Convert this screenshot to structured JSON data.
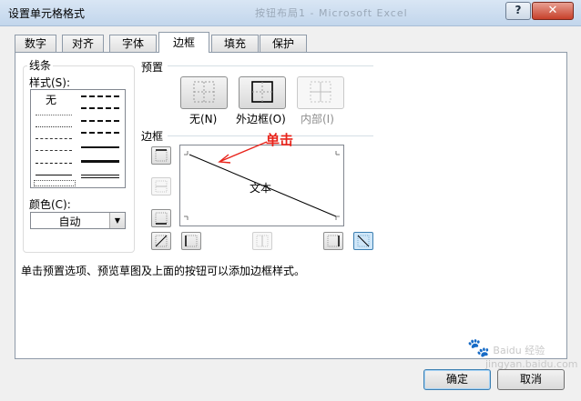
{
  "window": {
    "title": "设置单元格格式",
    "faded_bg_title": "按钮布局1 - Microsoft Excel",
    "help_label": "?",
    "close_label": "✕"
  },
  "tabs": [
    {
      "label": "数字"
    },
    {
      "label": "对齐"
    },
    {
      "label": "字体"
    },
    {
      "label": "边框",
      "active": true
    },
    {
      "label": "填充"
    },
    {
      "label": "保护"
    }
  ],
  "line": {
    "group_label": "线条",
    "style_label": "样式(S):",
    "none_label": "无",
    "color_label": "颜色(C):",
    "color_value": "自动"
  },
  "presets": {
    "group_label": "预置",
    "none_label": "无(N)",
    "outline_label": "外边框(O)",
    "inside_label": "内部(I)"
  },
  "border": {
    "group_label": "边框",
    "preview_text": "文本"
  },
  "annotation": {
    "text": "单击",
    "color": "#e8231a"
  },
  "hint": "单击预置选项、预览草图及上面的按钮可以添加边框样式。",
  "buttons": {
    "ok": "确定",
    "cancel": "取消"
  },
  "watermark": {
    "text": "Baidu 经验",
    "sub": "jingyan.baidu.com"
  }
}
